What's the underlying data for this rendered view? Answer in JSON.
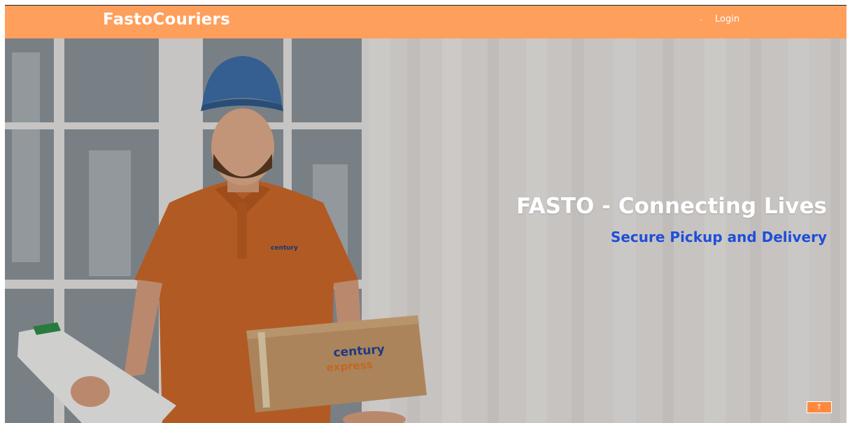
{
  "navbar": {
    "brand": "FastoCouriers",
    "login_label": "Login",
    "background_color": "#ff9f5c"
  },
  "hero": {
    "title": "FASTO - Connecting Lives",
    "subtitle": "Secure Pickup and Delivery",
    "subtitle_color": "#1e4fd8",
    "photo_logo_text_line1": "century",
    "photo_logo_text_line2": "express"
  },
  "back_to_top": {
    "icon": "arrow-up-icon",
    "glyph": "↑",
    "color": "#ff8a3d"
  }
}
